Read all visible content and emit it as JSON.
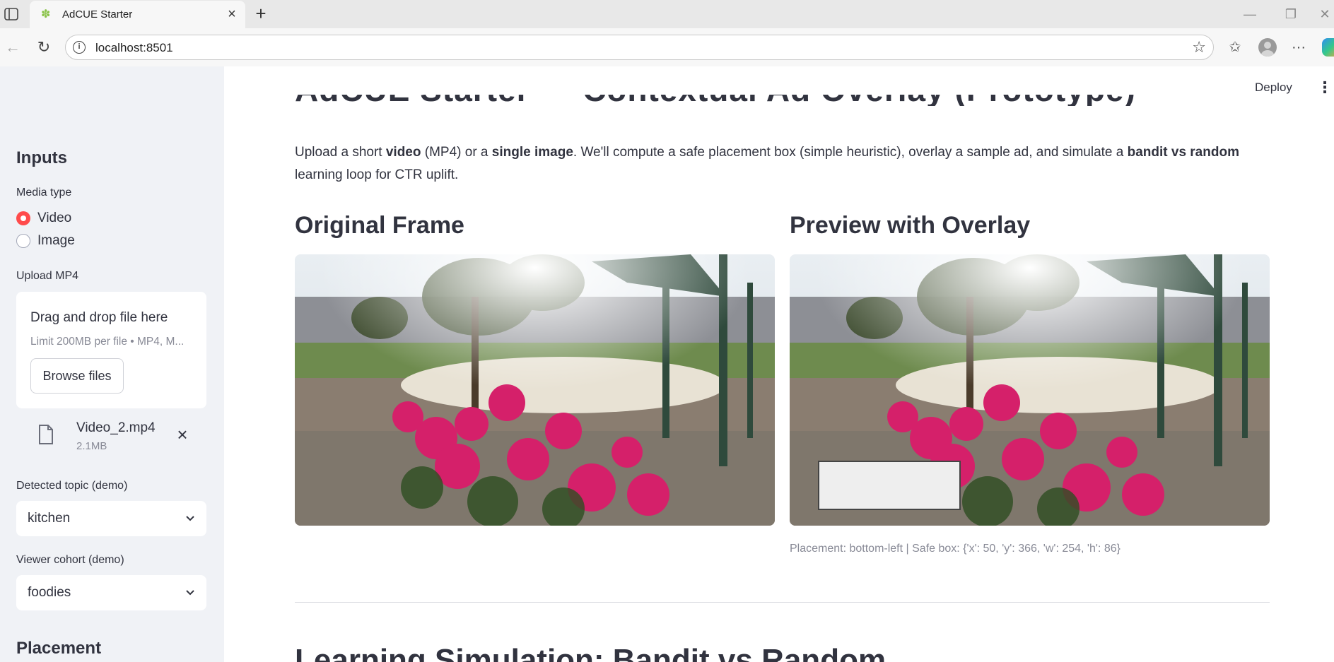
{
  "browser": {
    "tab_title": "AdCUE Starter",
    "url": "localhost:8501"
  },
  "sidebar": {
    "inputs_heading": "Inputs",
    "media_type_label": "Media type",
    "media_options": [
      "Video",
      "Image"
    ],
    "media_selected": "Video",
    "upload_label": "Upload MP4",
    "dropzone_title": "Drag and drop file here",
    "dropzone_limit": "Limit 200MB per file • MP4, M...",
    "browse_label": "Browse files",
    "file_name": "Video_2.mp4",
    "file_size": "2.1MB",
    "topic_label": "Detected topic (demo)",
    "topic_value": "kitchen",
    "cohort_label": "Viewer cohort (demo)",
    "cohort_value": "foodies",
    "placement_heading": "Placement"
  },
  "main": {
    "deploy_label": "Deploy",
    "page_title": "AdCUE Starter — Contextual Ad Overlay (Prototype)",
    "intro": {
      "p1": "Upload a short ",
      "b1": "video",
      "p2": " (MP4) or a ",
      "b2": "single image",
      "p3": ". We'll compute a safe placement box (simple heuristic), overlay a sample ad, and simulate a ",
      "b3": "bandit vs random",
      "p4": " learning loop for CTR uplift."
    },
    "original_heading": "Original Frame",
    "preview_heading": "Preview with Overlay",
    "caption": "Placement: bottom-left | Safe box: {'x': 50, 'y': 366, 'w': 254, 'h': 86}",
    "next_section_heading": "Learning Simulation: Bandit vs Random"
  },
  "colors": {
    "accent": "#ff4b4b",
    "sidebar_bg": "#f0f2f6",
    "text": "#31333f",
    "muted": "#888a96"
  }
}
